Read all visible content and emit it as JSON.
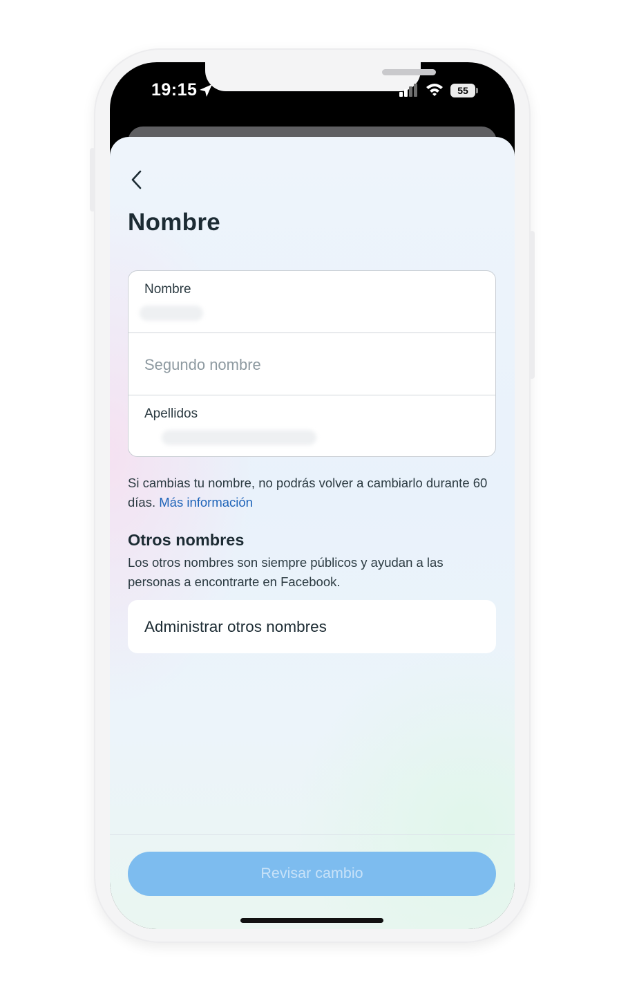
{
  "status_bar": {
    "time": "19:15",
    "battery": "55"
  },
  "header": {
    "title": "Nombre"
  },
  "form": {
    "first_name_label": "Nombre",
    "middle_name_placeholder": "Segundo nombre",
    "last_name_label": "Apellidos"
  },
  "info": {
    "text": "Si cambias tu nombre, no podrás volver a cambiarlo durante 60 días. ",
    "link": "Más información"
  },
  "other_names": {
    "title": "Otros nombres",
    "description": "Los otros nombres son siempre públicos y ayudan a las personas a encontrarte en Facebook.",
    "manage_label": "Administrar otros nombres"
  },
  "footer": {
    "review_label": "Revisar cambio"
  },
  "icons": {
    "back": "chevron-left-icon",
    "location": "location-arrow-icon",
    "signal": "cellular-signal-icon",
    "wifi": "wifi-icon",
    "battery": "battery-icon"
  },
  "colors": {
    "link": "#1d63b8",
    "primary_button_disabled": "#7dbcef",
    "title_text": "#1c2b33"
  }
}
